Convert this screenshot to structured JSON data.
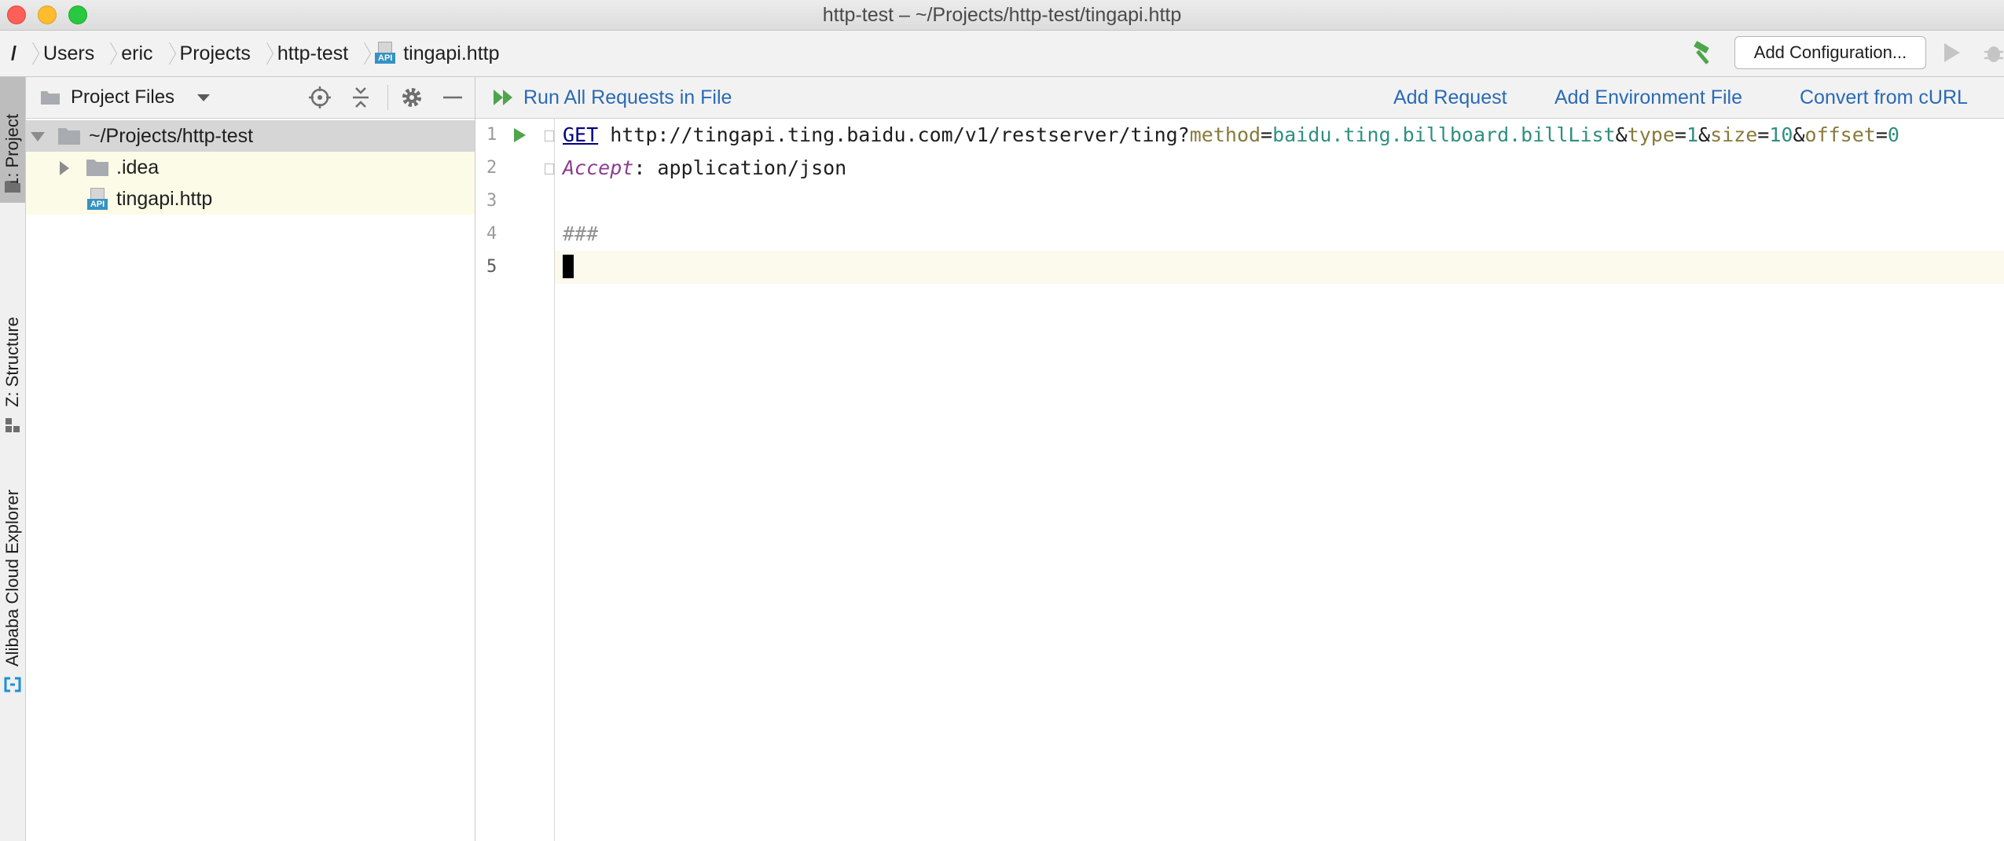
{
  "window": {
    "title": "http-test – ~/Projects/http-test/tingapi.http"
  },
  "breadcrumb": {
    "root": "/",
    "items": [
      "Users",
      "eric",
      "Projects",
      "http-test",
      "tingapi.http"
    ]
  },
  "run_toolbar": {
    "config_label": "Add Configuration..."
  },
  "tool_strip": {
    "project_tab": "1: Project",
    "structure_tab": "Z: Structure",
    "cloud_tab": "Alibaba Cloud Explorer"
  },
  "project_panel": {
    "view_label": "Project Files",
    "tree": {
      "root": "~/Projects/http-test",
      "folder": ".idea",
      "file": "tingapi.http"
    }
  },
  "editor_toolbar": {
    "run_all": "Run All Requests in File",
    "add_request": "Add Request",
    "add_env": "Add Environment File",
    "convert_curl": "Convert from cURL"
  },
  "editor": {
    "line_numbers": [
      "1",
      "2",
      "3",
      "4",
      "5"
    ],
    "line1": {
      "method": "GET",
      "url": " http://tingapi.ting.baidu.com/v1/restserver/ting?",
      "p1_key": "method",
      "p1_val": "baidu.ting.billboard.billList",
      "p2_key": "type",
      "p2_val": "1",
      "p3_key": "size",
      "p3_val": "10",
      "p4_key": "offset",
      "p4_val": "0",
      "eq": "=",
      "amp": "&"
    },
    "line2": {
      "header_name": "Accept",
      "header_rest": ": application/json"
    },
    "line4": {
      "separator": "###"
    }
  },
  "colors": {
    "accent_link": "#2a6ab5",
    "run_green": "#4ea54b",
    "get_keyword": "#000080",
    "param_key": "#887a3c",
    "param_value": "#2f8f80",
    "header_name": "#8a3d8e"
  }
}
